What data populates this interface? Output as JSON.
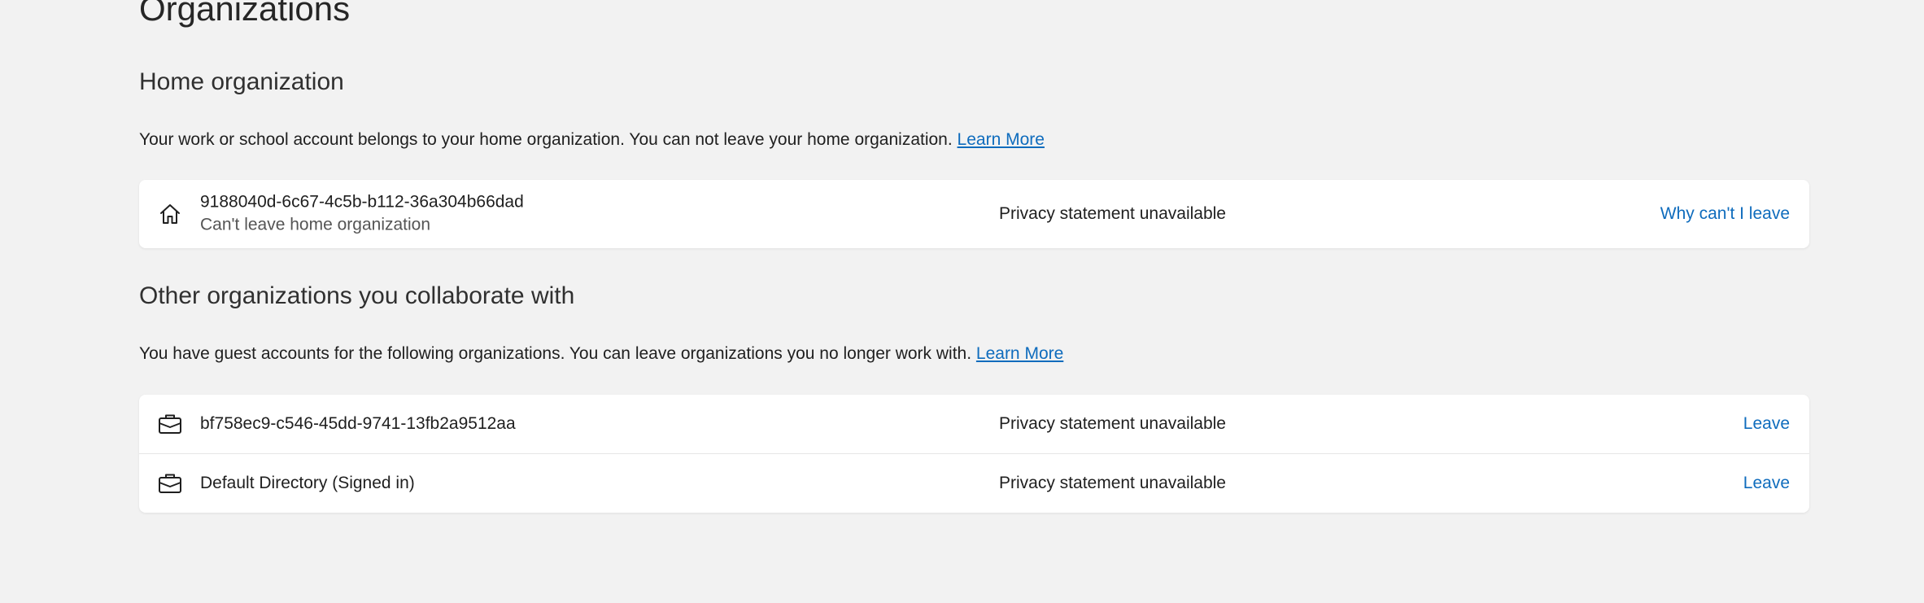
{
  "page": {
    "title": "Organizations"
  },
  "home": {
    "heading": "Home organization",
    "description": "Your work or school account belongs to your home organization. You can not leave your home organization.",
    "learn_more": "Learn More",
    "org": {
      "icon": "home-icon",
      "name": "9188040d-6c67-4c5b-b112-36a304b66dad",
      "subtitle": "Can't leave home organization",
      "privacy": "Privacy statement unavailable",
      "action": "Why can't I leave"
    }
  },
  "other": {
    "heading": "Other organizations you collaborate with",
    "description": "You have guest accounts for the following organizations. You can leave organizations you no longer work with.",
    "learn_more": "Learn More",
    "orgs": [
      {
        "icon": "briefcase-icon",
        "name": "bf758ec9-c546-45dd-9741-13fb2a9512aa",
        "privacy": "Privacy statement unavailable",
        "action": "Leave"
      },
      {
        "icon": "briefcase-icon",
        "name": "Default Directory (Signed in)",
        "privacy": "Privacy statement unavailable",
        "action": "Leave"
      }
    ]
  },
  "colors": {
    "background": "#f2f2f2",
    "card": "#ffffff",
    "link": "#0f6cbd",
    "text": "#1f1f1f"
  }
}
